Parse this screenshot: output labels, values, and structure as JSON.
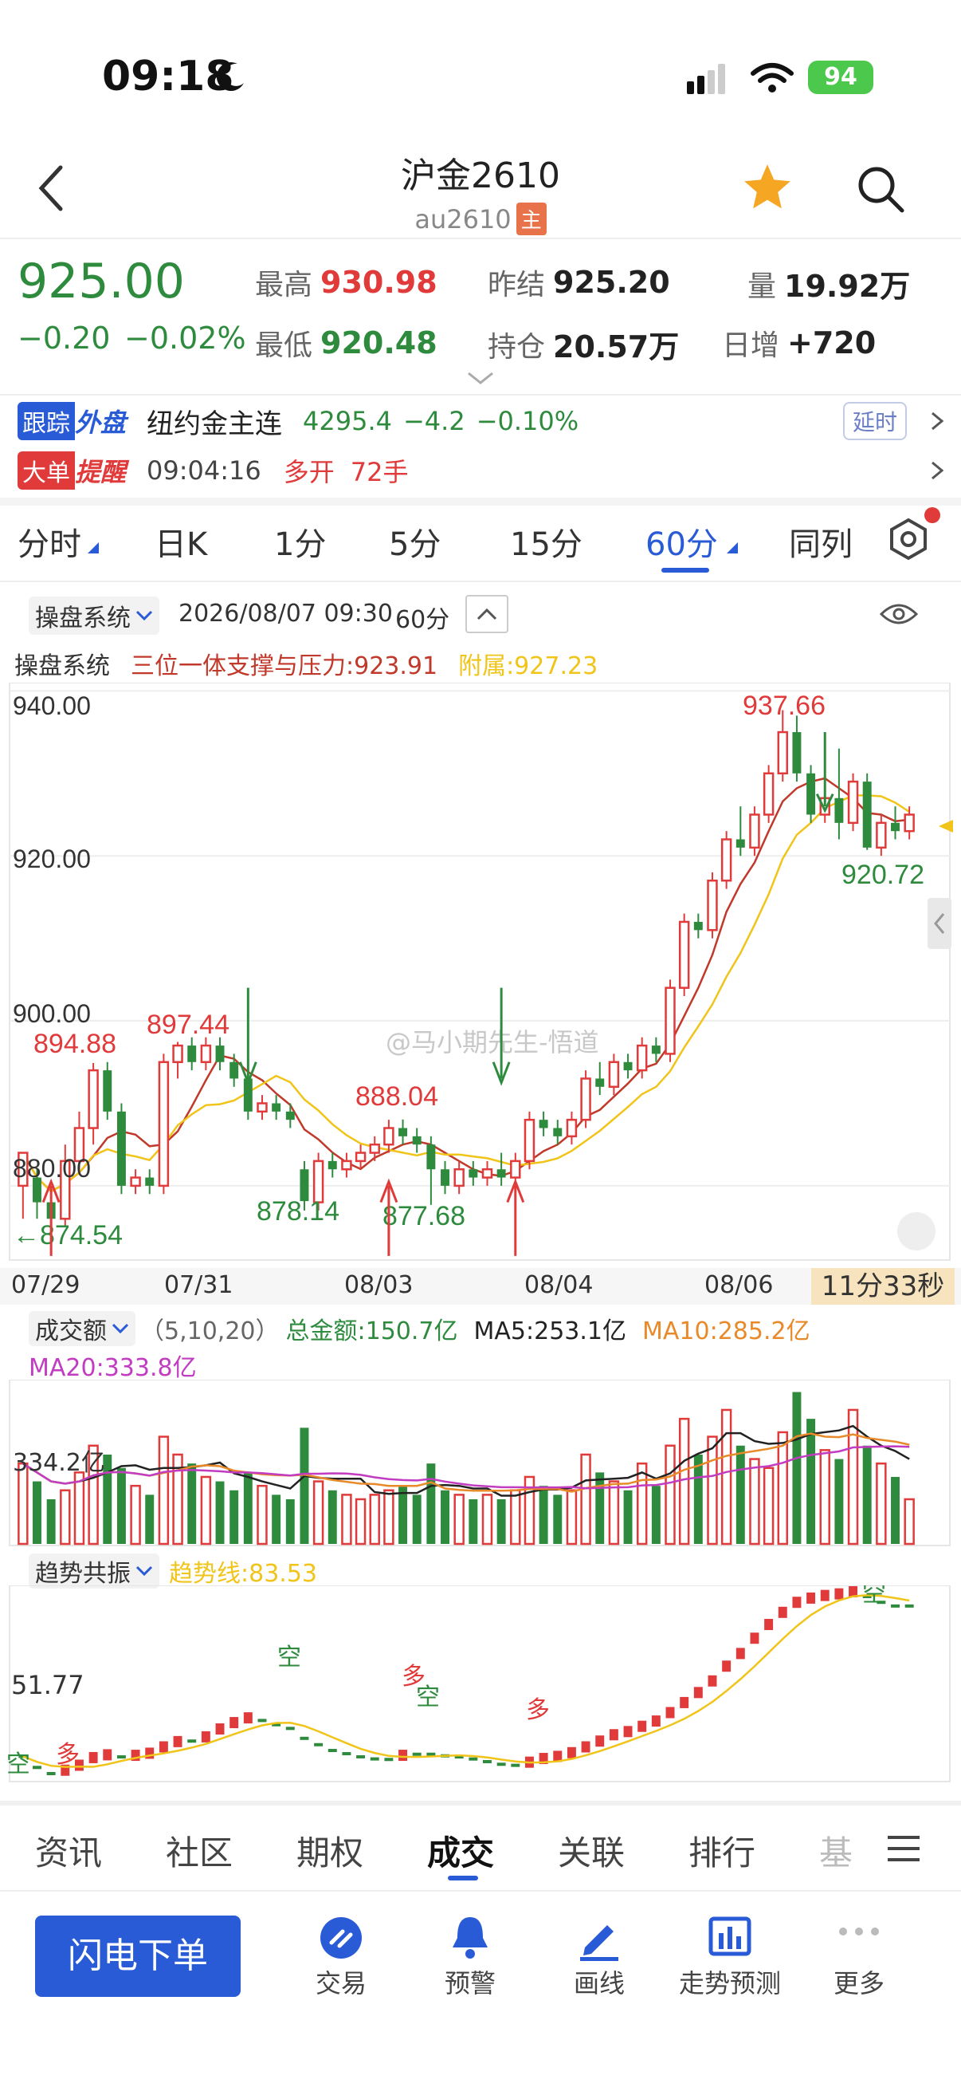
{
  "status": {
    "time": "09:18",
    "battery": "94"
  },
  "header": {
    "title": "沪金2610",
    "code": "au2610",
    "main_tag": "主"
  },
  "quote": {
    "price": "925.00",
    "change": "−0.20",
    "change_pct": "−0.02%",
    "high_label": "最高",
    "high": "930.98",
    "low_label": "最低",
    "low": "920.48",
    "prev_settle_label": "昨结",
    "prev_settle": "925.20",
    "position_label": "持仓",
    "position": "20.57万",
    "volume_label": "量",
    "volume": "19.92万",
    "daily_inc_label": "日增",
    "daily_inc": "+720"
  },
  "track": {
    "tag1": "跟踪",
    "tag2": "外盘",
    "name": "纽约金主连",
    "price": "4295.4",
    "change": "−4.2",
    "pct": "−0.10%",
    "delay": "延时"
  },
  "alert": {
    "tag1": "大单",
    "tag2": "提醒",
    "time": "09:04:16",
    "action": "多开",
    "amount": "72手"
  },
  "period_tabs": [
    "分时",
    "日K",
    "1分",
    "5分",
    "15分",
    "60分",
    "同列"
  ],
  "chart_head": {
    "system": "操盘系统",
    "datetime": "2026/08/07 09:30",
    "period": "60分"
  },
  "indicator_line": {
    "name": "操盘系统",
    "support": "三位一体支撑与压力:923.91",
    "attach": "附属:927.23"
  },
  "annotations": {
    "hi": "937.66",
    "lo_right": "920.72",
    "a1": "894.88",
    "a2": "897.44",
    "a3": "888.04",
    "b1": "874.54",
    "b2": "878.14",
    "b3": "877.68",
    "watermark": "@马小期先生-悟道"
  },
  "countdown": "11分33秒",
  "volume_head": {
    "name": "成交额",
    "params": "（5,10,20）",
    "total": "总金额:150.7亿",
    "ma5": "MA5:253.1亿",
    "ma10": "MA10:285.2亿",
    "ma20": "MA20:333.8亿",
    "axis_label": "334.2亿"
  },
  "trend_head": {
    "name": "趋势共振",
    "line": "趋势线:83.53",
    "axis_label": "51.77",
    "marks": [
      "空",
      "多",
      "空",
      "多",
      "空",
      "多",
      "空"
    ]
  },
  "bottom_tabs": [
    "资讯",
    "社区",
    "期权",
    "成交",
    "关联",
    "排行",
    "基"
  ],
  "toolbar": {
    "order_button": "闪电下单",
    "trade": "交易",
    "alert": "预警",
    "draw": "画线",
    "forecast": "走势预测",
    "more": "更多"
  },
  "colors": {
    "up": "#e03a3a",
    "down": "#2e8b3e",
    "accent": "#2a5bd7",
    "ma_red": "#c0392b",
    "ma_yellow": "#f0c419"
  },
  "chart_data": {
    "type": "candlestick",
    "title": "",
    "y_ticks": [
      "940.00",
      "920.00",
      "900.00",
      "880.00"
    ],
    "ylim": [
      871,
      941
    ],
    "x_ticks": [
      "07/29",
      "07/31",
      "08/03",
      "08/04",
      "08/06"
    ],
    "candles": [
      [
        880,
        884,
        876,
        881
      ],
      [
        881,
        878,
        876,
        882
      ],
      [
        878,
        876,
        874.54,
        879
      ],
      [
        876,
        883,
        875,
        885
      ],
      [
        883,
        887,
        882,
        889
      ],
      [
        887,
        894,
        885,
        894.88
      ],
      [
        894,
        889,
        888,
        895
      ],
      [
        889,
        880,
        879,
        890
      ],
      [
        880,
        881,
        879,
        882
      ],
      [
        881,
        880,
        879,
        882
      ],
      [
        880,
        895,
        879,
        896
      ],
      [
        895,
        897,
        893,
        897.44
      ],
      [
        897,
        895,
        894,
        898
      ],
      [
        895,
        897,
        894,
        898
      ],
      [
        897,
        895,
        894,
        898
      ],
      [
        895,
        893,
        892,
        896
      ],
      [
        893,
        889,
        888,
        894
      ],
      [
        889,
        890,
        888,
        891
      ],
      [
        890,
        889,
        888,
        891
      ],
      [
        889,
        888,
        887,
        890
      ],
      [
        882,
        878.14,
        877,
        883
      ],
      [
        878,
        883,
        877,
        884
      ],
      [
        883,
        882,
        881,
        884
      ],
      [
        882,
        883,
        881,
        884
      ],
      [
        883,
        884,
        882,
        885
      ],
      [
        884,
        885,
        883,
        886
      ],
      [
        885,
        887,
        884,
        888
      ],
      [
        887,
        886,
        885,
        888.04
      ],
      [
        886,
        885,
        884,
        887
      ],
      [
        885,
        882,
        877.68,
        886
      ],
      [
        882,
        880,
        879,
        883
      ],
      [
        880,
        882,
        879,
        883
      ],
      [
        882,
        881,
        880,
        883
      ],
      [
        881,
        882,
        880,
        883
      ],
      [
        882,
        881,
        880,
        884
      ],
      [
        881,
        883,
        880,
        884
      ],
      [
        883,
        888,
        882,
        889
      ],
      [
        888,
        887,
        886,
        889
      ],
      [
        887,
        886,
        885,
        888
      ],
      [
        886,
        888,
        885,
        889
      ],
      [
        888,
        893,
        887,
        894
      ],
      [
        893,
        892,
        891,
        895
      ],
      [
        892,
        895,
        891,
        896
      ],
      [
        895,
        894,
        893,
        896
      ],
      [
        894,
        897,
        893,
        898
      ],
      [
        897,
        896,
        895,
        898
      ],
      [
        896,
        904,
        895,
        905
      ],
      [
        904,
        912,
        903,
        913
      ],
      [
        912,
        911,
        910,
        913
      ],
      [
        911,
        917,
        910,
        918
      ],
      [
        917,
        922,
        916,
        923
      ],
      [
        922,
        921,
        920,
        926
      ],
      [
        921,
        925,
        920,
        926
      ],
      [
        925,
        930,
        924,
        931
      ],
      [
        930,
        935,
        929,
        937.66
      ],
      [
        935,
        930,
        929,
        937
      ],
      [
        930,
        925,
        924,
        931
      ],
      [
        925,
        927,
        924,
        928
      ],
      [
        927,
        924,
        922,
        933
      ],
      [
        924,
        929,
        923,
        930
      ],
      [
        929,
        921,
        920.72,
        930
      ],
      [
        921,
        924,
        920,
        925
      ],
      [
        924,
        923,
        922,
        926
      ],
      [
        923,
        925,
        922,
        926
      ]
    ],
    "volume": [
      18,
      14,
      10,
      12,
      16,
      22,
      20,
      17,
      13,
      11,
      24,
      20,
      18,
      15,
      14,
      12,
      16,
      13,
      11,
      10,
      26,
      14,
      12,
      11,
      10,
      11,
      12,
      13,
      11,
      18,
      12,
      11,
      10,
      11,
      10,
      12,
      15,
      13,
      11,
      12,
      20,
      16,
      14,
      12,
      18,
      13,
      22,
      28,
      20,
      24,
      30,
      22,
      19,
      17,
      25,
      34,
      28,
      21,
      19,
      30,
      22,
      18,
      15,
      10
    ]
  }
}
